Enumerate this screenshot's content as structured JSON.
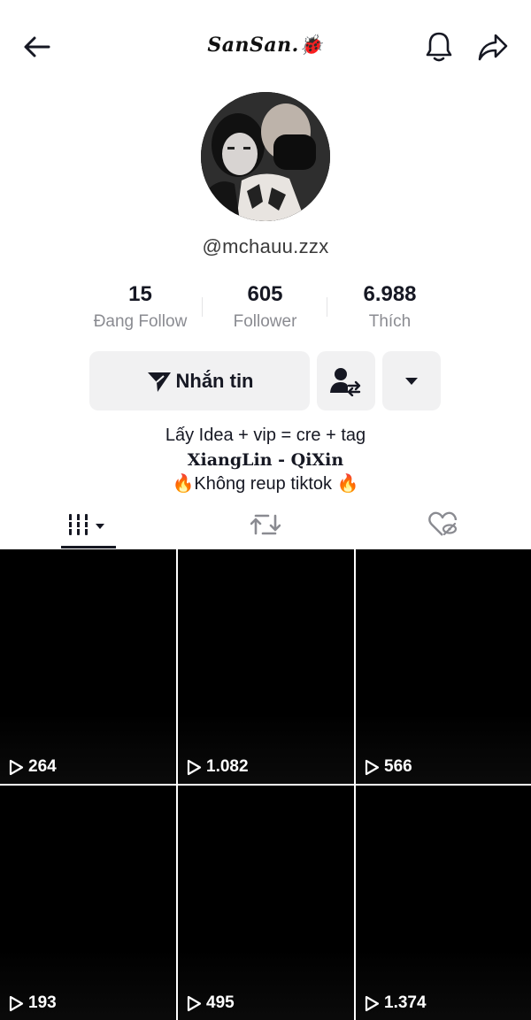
{
  "header": {
    "title": "SanSan.🐞",
    "back_icon": "arrow-left-icon",
    "bell_icon": "bell-icon",
    "share_icon": "share-arrow-icon"
  },
  "profile": {
    "username": "@mchauu.zzx",
    "avatar": "avatar-photo"
  },
  "stats": [
    {
      "value": "15",
      "label": "Đang Follow"
    },
    {
      "value": "605",
      "label": "Follower"
    },
    {
      "value": "6.988",
      "label": "Thích"
    }
  ],
  "actions": {
    "message_label": "Nhắn tin",
    "message_icon": "send-icon",
    "friend_icon": "swap-friend-icon",
    "more_icon": "caret-down-icon"
  },
  "bio": {
    "line1": "Lấy Idea + vip = cre + tag",
    "line2": "XiangLin - QiXin",
    "line3": "🔥Không reup tiktok 🔥"
  },
  "tabs": [
    {
      "name": "videos",
      "icon": "grid-lines-icon",
      "active": true
    },
    {
      "name": "reposts",
      "icon": "repost-icon",
      "active": false
    },
    {
      "name": "liked",
      "icon": "hidden-heart-icon",
      "active": false
    }
  ],
  "videos": [
    {
      "views": "264"
    },
    {
      "views": "1.082"
    },
    {
      "views": "566"
    },
    {
      "views": "193"
    },
    {
      "views": "495"
    },
    {
      "views": "1.374"
    }
  ],
  "colors": {
    "text": "#161823",
    "secondary_text": "#8a8b91",
    "button_bg": "#f1f1f2",
    "video_bg": "#000000"
  }
}
